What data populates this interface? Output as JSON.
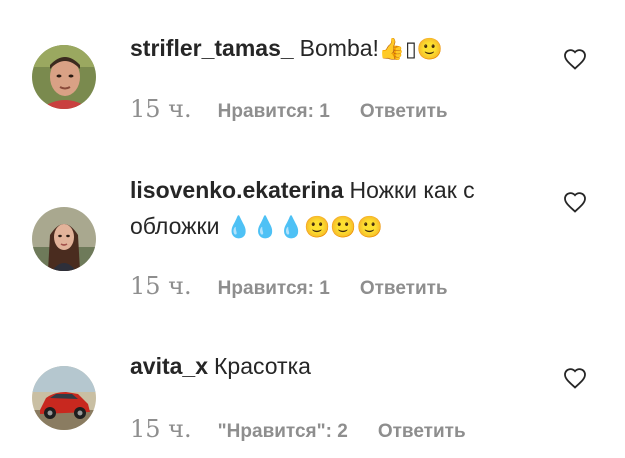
{
  "comments": [
    {
      "username": "strifler_tamas_",
      "text": "Bomba!",
      "emoji": "👍▯🙂",
      "time": "15 ч.",
      "likes": "Нравится: 1",
      "reply": "Ответить"
    },
    {
      "username": "lisovenko.ekaterina",
      "text": "Ножки как с обложки",
      "emoji": "💧💧💧🙂🙂🙂",
      "time": "15 ч.",
      "likes": "Нравится: 1",
      "reply": "Ответить"
    },
    {
      "username": "avita_x",
      "text": "Красотка",
      "emoji": "",
      "time": "15 ч.",
      "likes": "\"Нравится\": 2",
      "reply": "Ответить"
    }
  ],
  "colors": {
    "text": "#262626",
    "meta": "#8e8e8e",
    "background": "#ffffff"
  },
  "icons": {
    "like": "heart-outline-icon"
  }
}
